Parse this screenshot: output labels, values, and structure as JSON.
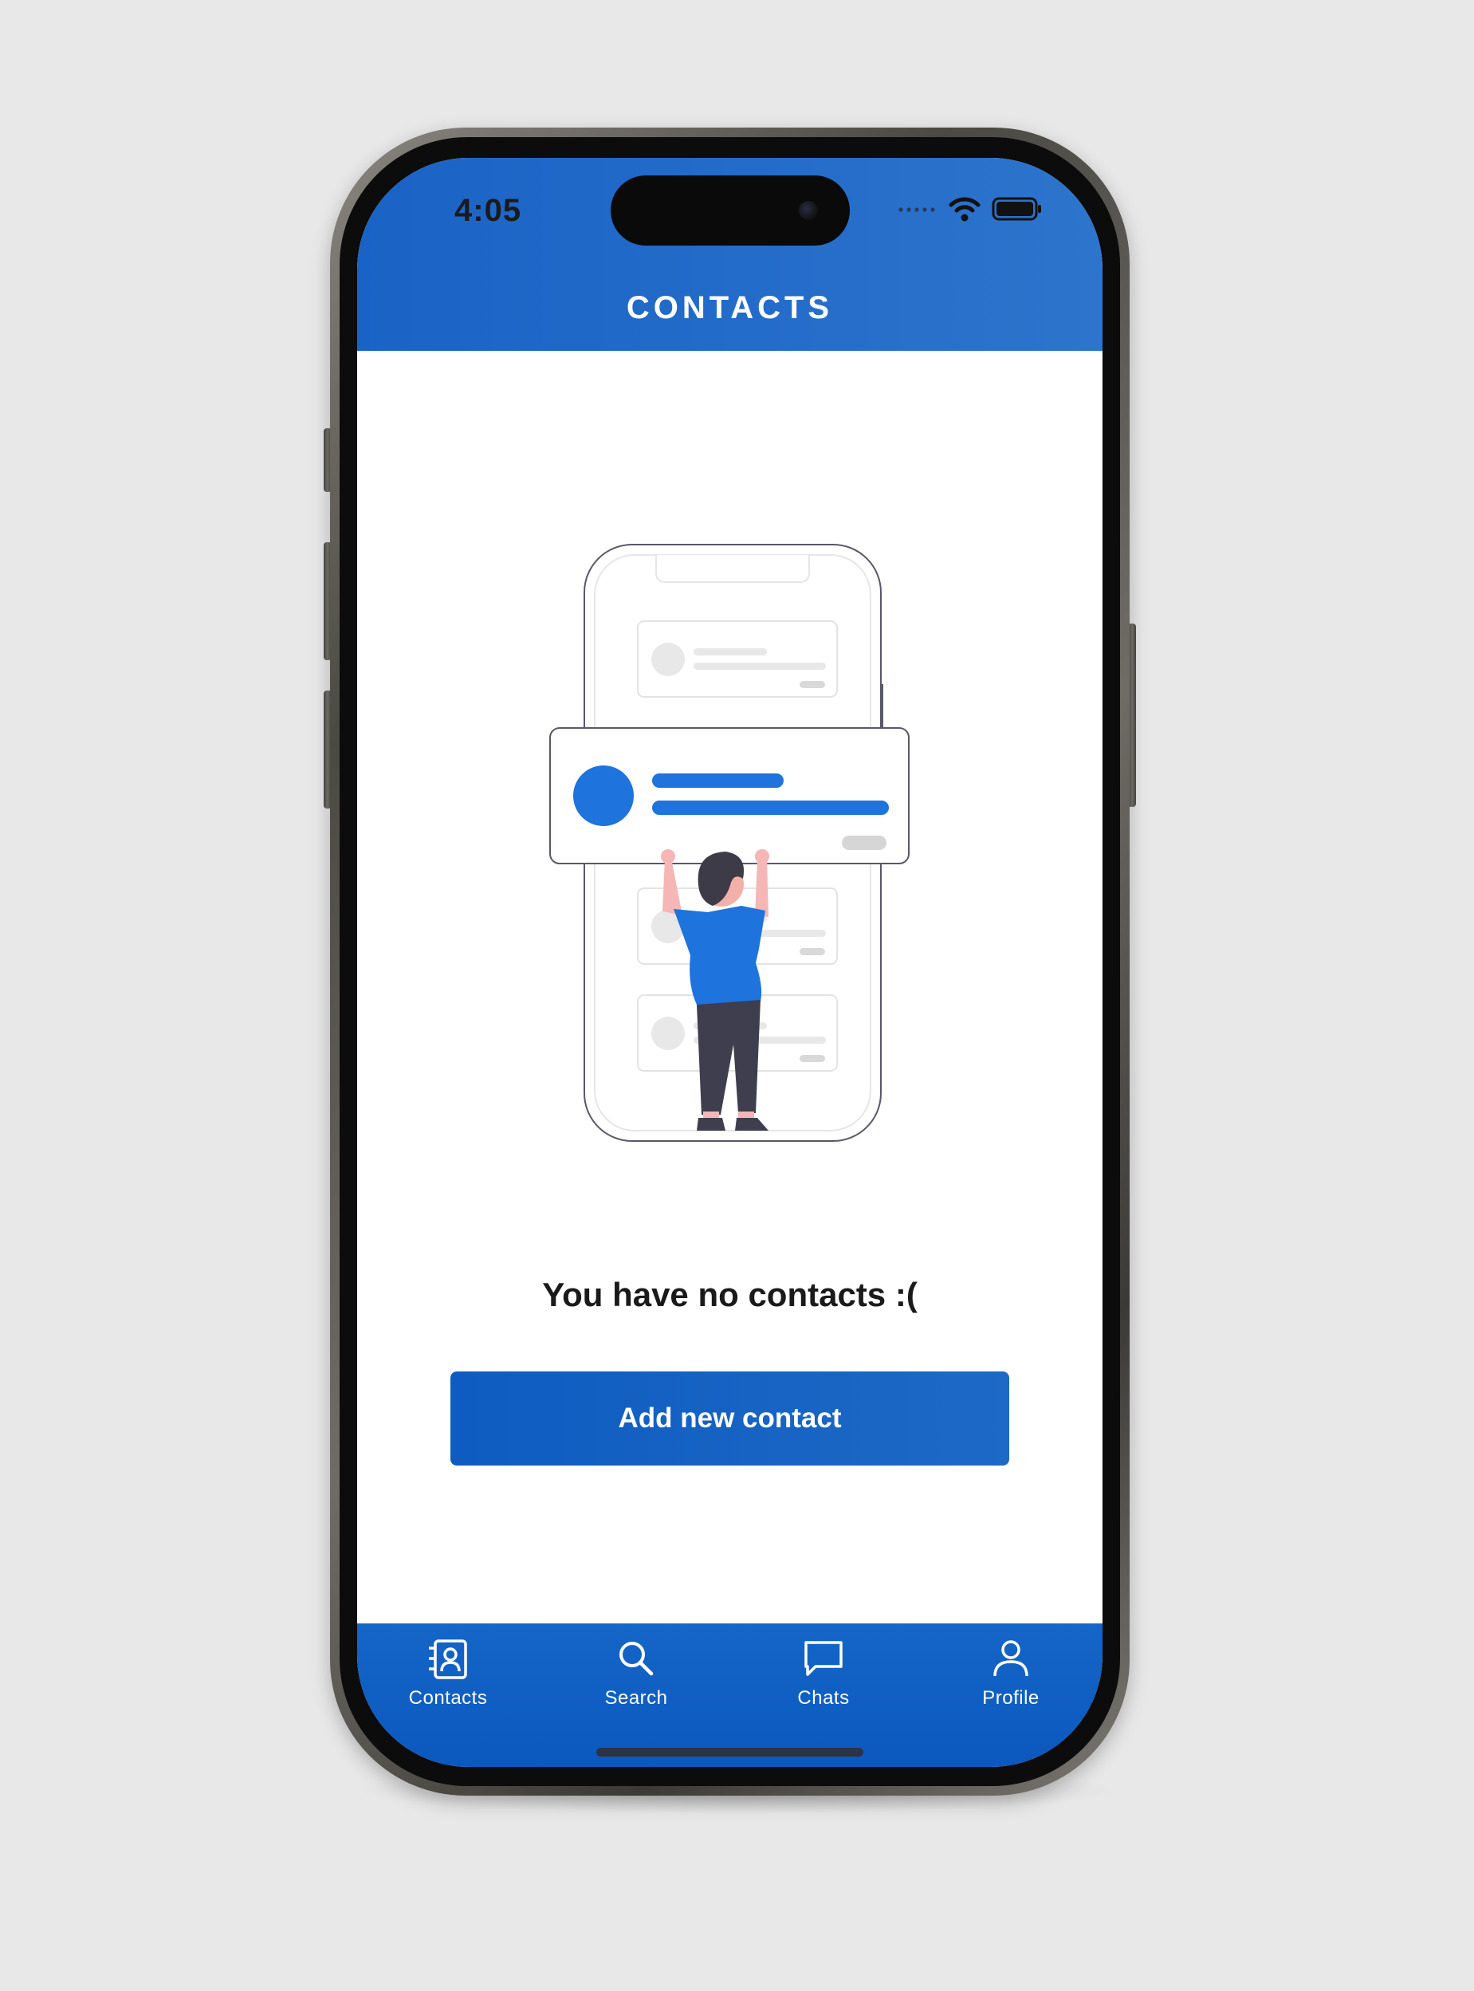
{
  "status_bar": {
    "time": "4:05"
  },
  "header": {
    "title": "CONTACTS"
  },
  "main": {
    "empty_message": "You have no contacts :(",
    "add_button_label": "Add new contact"
  },
  "bottom_nav": {
    "items": [
      {
        "label": "Contacts",
        "icon": "contacts-icon"
      },
      {
        "label": "Search",
        "icon": "search-icon"
      },
      {
        "label": "Chats",
        "icon": "chat-icon"
      },
      {
        "label": "Profile",
        "icon": "profile-icon"
      }
    ]
  },
  "colors": {
    "brand_blue": "#1a63c6",
    "button_blue": "#0e5cc1",
    "nav_blue": "#1566c8",
    "illustration_accent": "#1e73dc",
    "text_dark": "#1a1a1a",
    "background": "#e8e8e8"
  }
}
